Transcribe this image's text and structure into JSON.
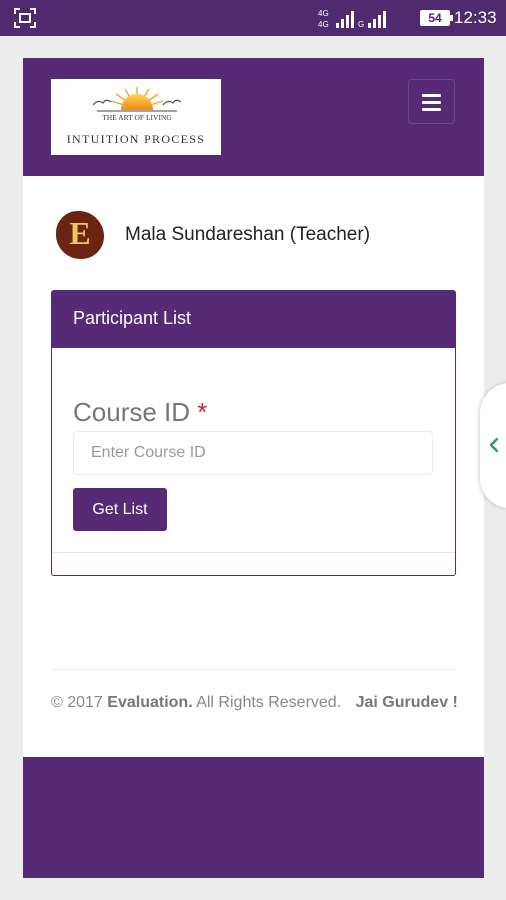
{
  "status_bar": {
    "left_icon": "screenshot-icon",
    "network_label": "4G",
    "battery": "54",
    "time": "12:33"
  },
  "header": {
    "logo_text": "THE ART OF LIVING",
    "logo_subtitle": "INTUITION PROCESS",
    "menu_icon": "hamburger-icon"
  },
  "profile": {
    "avatar_letter": "E",
    "name": "Mala Sundareshan (Teacher)"
  },
  "participant_panel": {
    "title": "Participant List",
    "field_label": "Course ID",
    "required_mark": "*",
    "course_input": {
      "value": "",
      "placeholder": "Enter Course ID"
    },
    "button_label": "Get List"
  },
  "footer": {
    "copyright_prefix": "© 2017",
    "brand": "Evaluation.",
    "rights": "All Rights Reserved.",
    "tagline": "Jai Gurudev !"
  },
  "colors": {
    "brand_purple": "#562a75",
    "status_bar": "#4f2a6e",
    "required_red": "#d9262b",
    "handle_green": "#2e9a74"
  }
}
